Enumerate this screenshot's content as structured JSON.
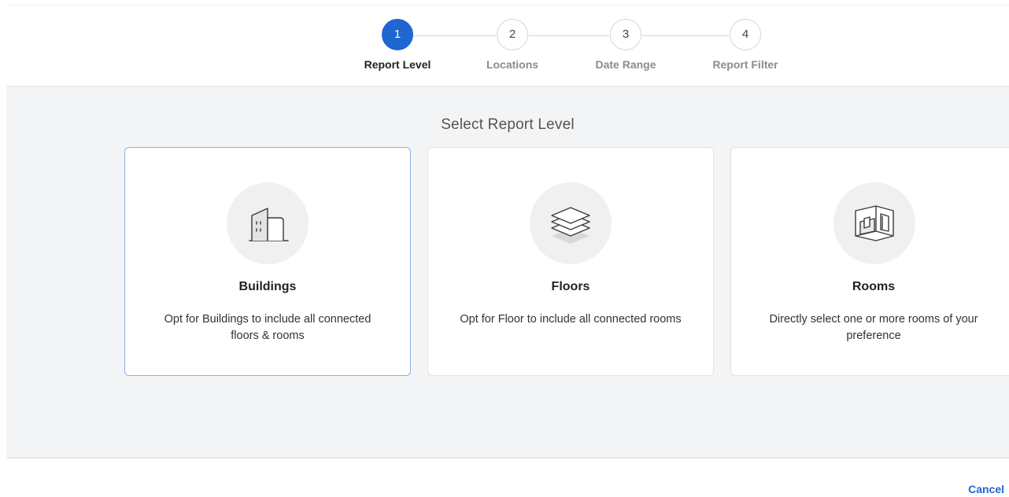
{
  "stepper": {
    "steps": [
      {
        "number": "1",
        "label": "Report Level",
        "active": true
      },
      {
        "number": "2",
        "label": "Locations",
        "active": false
      },
      {
        "number": "3",
        "label": "Date Range",
        "active": false
      },
      {
        "number": "4",
        "label": "Report Filter",
        "active": false
      }
    ]
  },
  "main": {
    "title": "Select Report Level",
    "cards": [
      {
        "icon": "building-icon",
        "title": "Buildings",
        "description": "Opt for Buildings to include all connected floors & rooms",
        "selected": true
      },
      {
        "icon": "layers-icon",
        "title": "Floors",
        "description": "Opt for Floor to include all connected rooms",
        "selected": false
      },
      {
        "icon": "room-icon",
        "title": "Rooms",
        "description": "Directly select one or more rooms of your preference",
        "selected": false
      }
    ]
  },
  "footer": {
    "cancel_label": "Cancel"
  },
  "colors": {
    "accent": "#1f66d1",
    "panel_background": "#f3f4f6",
    "selected_border": "#8fb2e6"
  }
}
